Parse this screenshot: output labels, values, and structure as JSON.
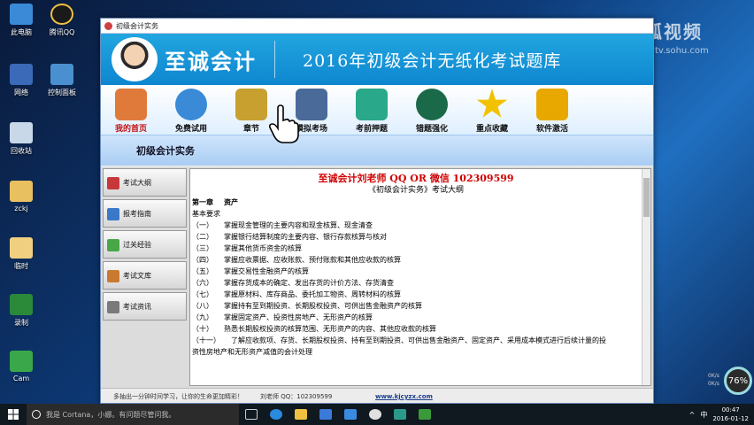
{
  "desktop": {
    "icons": [
      {
        "label": "此电脑"
      },
      {
        "label": "腾讯QQ"
      },
      {
        "label": "网络"
      },
      {
        "label": "控制面板"
      },
      {
        "label": "回收站"
      },
      {
        "label": "zckj"
      },
      {
        "label": "临时"
      },
      {
        "label": "录制"
      },
      {
        "label": "Cam"
      }
    ],
    "watermark": {
      "main": "搜狐视频",
      "sub": "tv.sohu.com"
    }
  },
  "window": {
    "title": "初级会计实务",
    "brand": "至诚会计",
    "banner_title": "2016年初级会计无纸化考试题库",
    "toolbar": [
      {
        "label": "我的首页",
        "icon": "home-icon",
        "color": "#e07a3a"
      },
      {
        "label": "免费试用",
        "icon": "clock-icon",
        "color": "#3a8ad8"
      },
      {
        "label": "章节",
        "icon": "books-icon",
        "color": "#c8a030"
      },
      {
        "label": "模拟考场",
        "icon": "monitor-icon",
        "color": "#4a6a9a"
      },
      {
        "label": "考前押题",
        "icon": "notebook-icon",
        "color": "#2aa88a"
      },
      {
        "label": "错题强化",
        "icon": "history-icon",
        "color": "#1a6a4a"
      },
      {
        "label": "重点收藏",
        "icon": "star-icon",
        "color": "#f2c200"
      },
      {
        "label": "软件激活",
        "icon": "lock-icon",
        "color": "#e8a800"
      }
    ],
    "section_title": "初级会计实务",
    "sidebar": [
      {
        "label": "考试大纲",
        "color": "#c83838"
      },
      {
        "label": "报考指南",
        "color": "#3a78c8"
      },
      {
        "label": "过关经验",
        "color": "#48a848"
      },
      {
        "label": "考试文库",
        "color": "#c87a30"
      },
      {
        "label": "考试资讯",
        "color": "#7a7a7a"
      }
    ],
    "content": {
      "headline": "至诚会计刘老师 QQ OR 微信 102309599",
      "subtitle": "《初级会计实务》考试大纲",
      "lines": [
        {
          "num": "第一章",
          "text": "资产",
          "bold": true
        },
        {
          "num": "",
          "text": "基本要求",
          "bold": false
        },
        {
          "num": "（一）",
          "text": "掌握现金管理的主要内容和现金核算、现金清查"
        },
        {
          "num": "（二）",
          "text": "掌握银行结算制度的主要内容、银行存款核算与核对"
        },
        {
          "num": "（三）",
          "text": "掌握其他货币资金的核算"
        },
        {
          "num": "（四）",
          "text": "掌握应收票据、应收账款、预付账款和其他应收款的核算"
        },
        {
          "num": "（五）",
          "text": "掌握交易性金融资产的核算"
        },
        {
          "num": "（六）",
          "text": "掌握存货成本的确定、发出存货的计价方法、存货清查"
        },
        {
          "num": "（七）",
          "text": "掌握原材料、库存商品、委托加工物资、周转材料的核算"
        },
        {
          "num": "（八）",
          "text": "掌握持有至到期投资、长期股权投资、可供出售金融资产的核算"
        },
        {
          "num": "（九）",
          "text": "掌握固定资产、投资性房地产、无形资产的核算"
        },
        {
          "num": "（十）",
          "text": "熟悉长期股权投资的核算范围、无形资产的内容、其他应收款的核算"
        },
        {
          "num": "（十一）",
          "text": "了解应收款项、存货、长期股权投资、持有至到期投资、可供出售金融资产、固定资产、采用成本模式进行后续计量的投"
        },
        {
          "num": "",
          "text": "资性房地产和无形资产减值的会计处理"
        }
      ]
    },
    "status": {
      "slogan": "多抽出一分钟时间学习，让你的生命更加精彩！",
      "contact": "刘老师 QQ：102309599",
      "site": "www.kjcyzx.com"
    }
  },
  "gauge": {
    "percent": "76%",
    "up": "0K/s",
    "down": "0K/s"
  },
  "taskbar": {
    "cortana_placeholder": "我是 Cortana，小娜。有问题尽管问我。",
    "tray": {
      "ime": "中",
      "time": "00:47",
      "date": "2016-01-12"
    },
    "apps": [
      {
        "icon": "task-view-icon",
        "color": "#cccccc"
      },
      {
        "icon": "edge-icon",
        "color": "#2a8ae0"
      },
      {
        "icon": "file-explorer-icon",
        "color": "#f0c040"
      },
      {
        "icon": "store-icon",
        "color": "#3a7ad8"
      },
      {
        "icon": "photos-icon",
        "color": "#3a8ae0"
      },
      {
        "icon": "qq-icon",
        "color": "#e0e0e0"
      },
      {
        "icon": "app-icon",
        "color": "#2a9a8a"
      },
      {
        "icon": "camtasia-icon",
        "color": "#3a9a3a"
      }
    ]
  }
}
